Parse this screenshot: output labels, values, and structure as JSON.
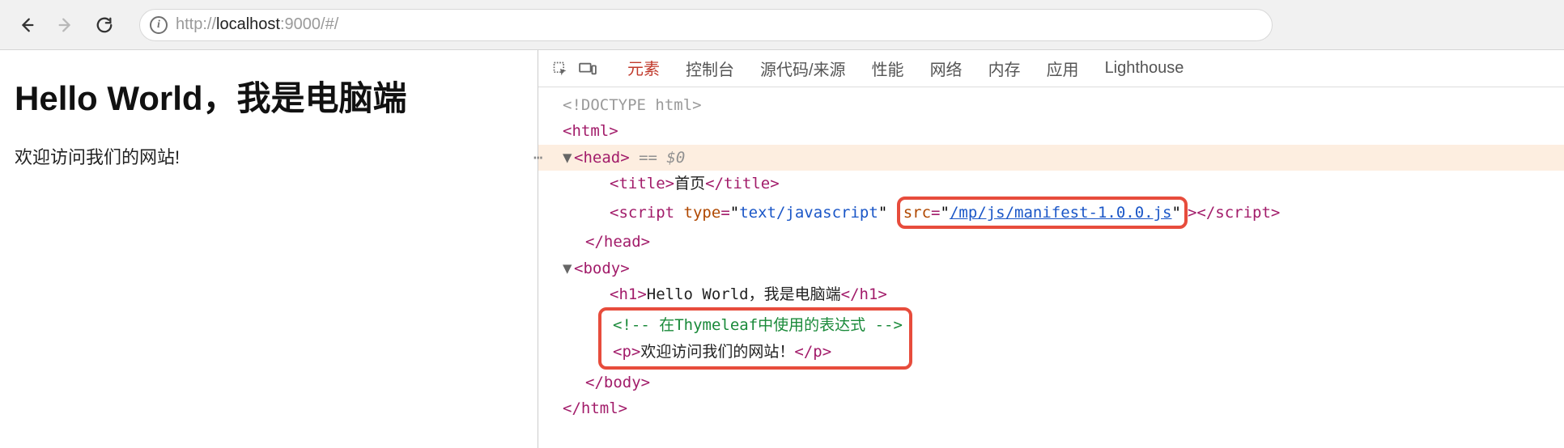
{
  "toolbar": {
    "url_prefix": "http://",
    "url_host": "localhost",
    "url_rest": ":9000/#/"
  },
  "page": {
    "heading": "Hello World，我是电脑端",
    "paragraph": "欢迎访问我们的网站!"
  },
  "devtools": {
    "tabs": {
      "elements": "元素",
      "console": "控制台",
      "sources": "源代码/来源",
      "performance": "性能",
      "network": "网络",
      "memory": "内存",
      "application": "应用",
      "lighthouse": "Lighthouse"
    },
    "dom": {
      "doctype": "<!DOCTYPE html>",
      "html_open": "html",
      "head_open": "head",
      "head_tail": " == $0",
      "title_tag": "title",
      "title_text": "首页",
      "script_tag": "script",
      "script_type_attr": "type",
      "script_type_val": "text/javascript",
      "script_src_attr": "src",
      "script_src_val": "/mp/js/manifest-1.0.0.js",
      "head_close": "/head",
      "body_open": "body",
      "h1_tag": "h1",
      "h1_text": "Hello World，我是电脑端",
      "comment_text": " 在Thymeleaf中使用的表达式 ",
      "p_tag": "p",
      "p_text": "欢迎访问我们的网站！",
      "body_close": "/body",
      "html_close": "/html"
    }
  }
}
